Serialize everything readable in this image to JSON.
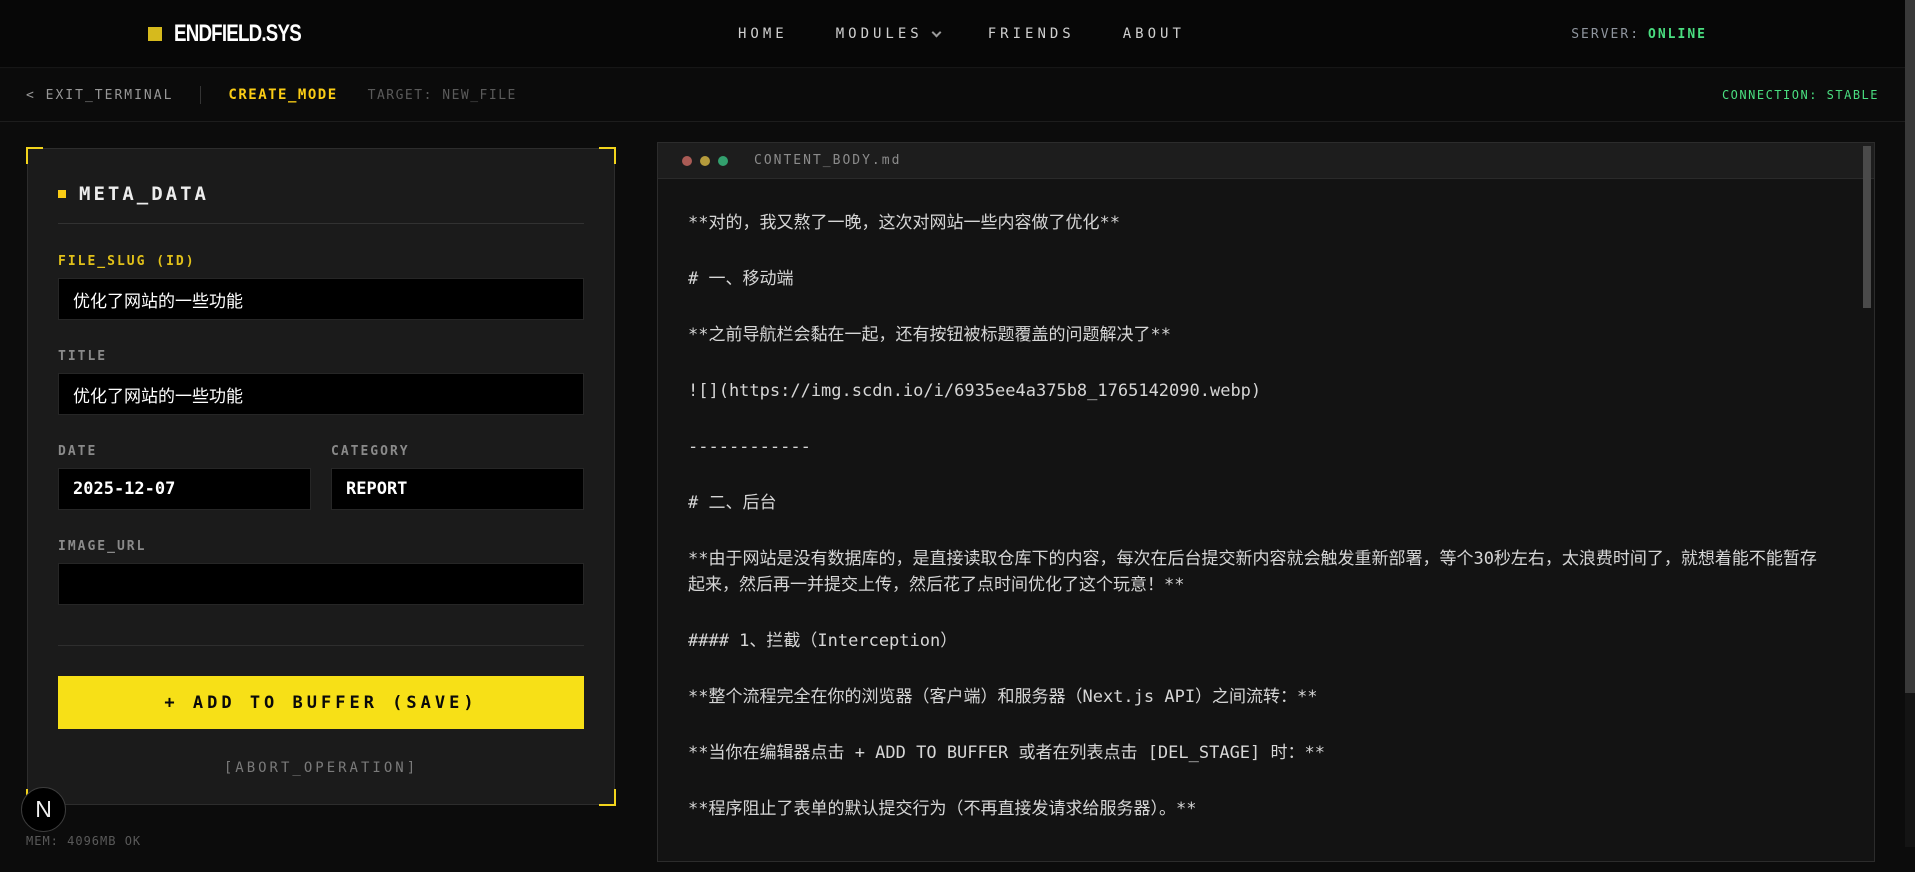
{
  "nav": {
    "logo": "ENDFIELD.SYS",
    "items": [
      {
        "label": "HOME",
        "dropdown": false
      },
      {
        "label": "MODULES",
        "dropdown": true
      },
      {
        "label": "FRIENDS",
        "dropdown": false
      },
      {
        "label": "ABOUT",
        "dropdown": false
      }
    ],
    "server_label": "SERVER:",
    "server_status": "ONLINE"
  },
  "toolbar": {
    "exit_label": "< EXIT_TERMINAL",
    "mode_label": "CREATE_MODE",
    "target_label": "TARGET: NEW_FILE",
    "connection_label": "CONNECTION: STABLE"
  },
  "form": {
    "header": "META_DATA",
    "fields": {
      "slug": {
        "label": "FILE_SLUG (ID)",
        "value": "优化了网站的一些功能"
      },
      "title": {
        "label": "TITLE",
        "value": "优化了网站的一些功能"
      },
      "date": {
        "label": "DATE",
        "value": "2025-12-07"
      },
      "category": {
        "label": "CATEGORY",
        "value": "REPORT"
      },
      "image_url": {
        "label": "IMAGE_URL",
        "value": ""
      }
    },
    "save_label": "+ ADD TO BUFFER (SAVE)",
    "abort_label": "[ABORT_OPERATION]"
  },
  "editor": {
    "filename": "CONTENT_BODY.md",
    "lines": [
      "**对的，我又熬了一晚，这次对网站一些内容做了优化**",
      "# 一、移动端",
      "**之前导航栏会黏在一起，还有按钮被标题覆盖的问题解决了**",
      "![](https://img.scdn.io/i/6935ee4a375b8_1765142090.webp)",
      "------------",
      "# 二、后台",
      "**由于网站是没有数据库的，是直接读取仓库下的内容，每次在后台提交新内容就会触发重新部署，等个30秒左右，太浪费时间了，就想着能不能暂存起来，然后再一并提交上传，然后花了点时间优化了这个玩意！**",
      "#### 1、拦截（Interception）",
      "**整个流程完全在你的浏览器（客户端）和服务器（Next.js API）之间流转：**",
      "**当你在编辑器点击 + ADD TO BUFFER 或者在列表点击 [DEL_STAGE] 时：**",
      "**程序阻止了表单的默认提交行为（不再直接发请求给服务器）。**"
    ]
  },
  "status": {
    "mem_label": "MEM: 4096MB OK"
  },
  "badge": {
    "letter": "N"
  },
  "colors": {
    "accent_yellow": "#facc15",
    "button_yellow": "#f7e017",
    "status_green": "#4ade80",
    "panel_bg": "#1b1b1b",
    "editor_bg": "#131313"
  }
}
